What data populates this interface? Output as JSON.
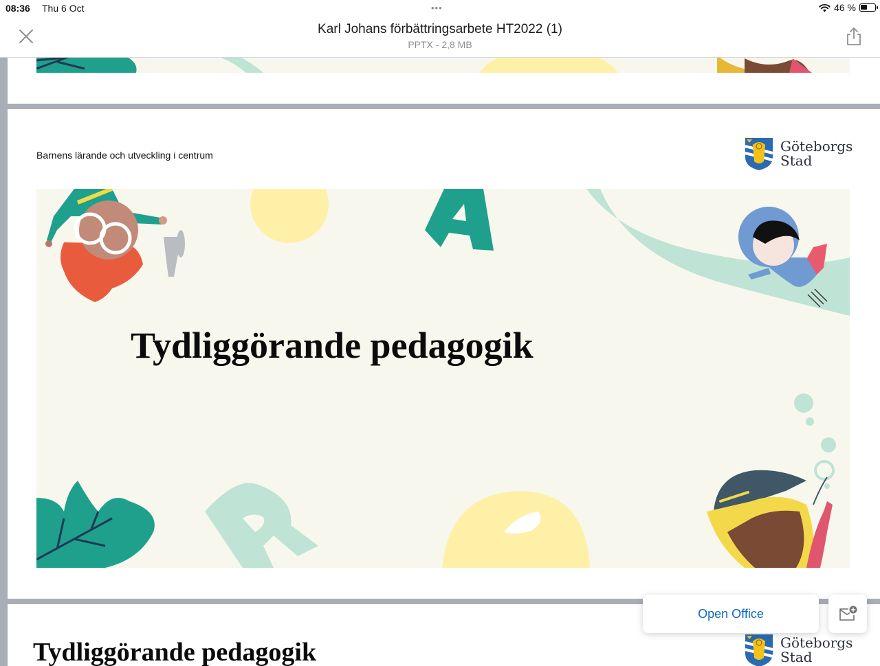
{
  "status_bar": {
    "time": "08:36",
    "date": "Thu 6 Oct",
    "multitask_dots": "•••",
    "battery_text": "46 %",
    "battery_level": 0.46
  },
  "header": {
    "title": "Karl Johans förbättringsarbete HT2022 (1)",
    "subtitle": "PPTX - 2,8 MB"
  },
  "slide": {
    "header_text": "Barnens lärande och utveckling i centrum",
    "logo_line1": "Göteborgs",
    "logo_line2": "Stad",
    "title": "Tydliggörande pedagogik"
  },
  "next_slide": {
    "title": "Tydliggörande pedagogik",
    "logo_line1": "Göteborgs",
    "logo_line2": "Stad"
  },
  "actions": {
    "open_office_label": "Open Office"
  },
  "colors": {
    "accent": "#0a66c2",
    "teal": "#1fa08c",
    "mint": "#bfe3d4",
    "yellow": "#fff0a8",
    "cream": "#f8f7ee",
    "coral": "#e85b3c"
  }
}
